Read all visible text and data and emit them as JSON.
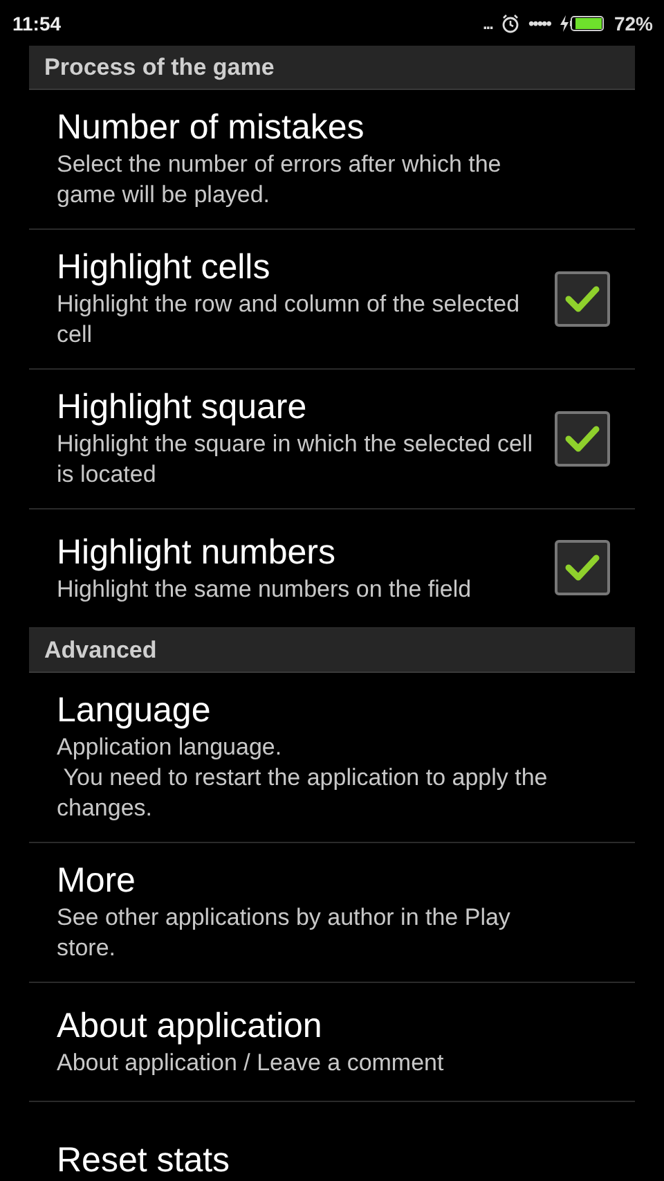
{
  "status_bar": {
    "time": "11:54",
    "overflow": "...",
    "signal": "•••••",
    "battery": "72%"
  },
  "sections": [
    {
      "title": "Process of the game",
      "items": [
        {
          "kind": "plain",
          "title": "Number of mistakes",
          "summary": "Select the number of errors after which the game will be played."
        },
        {
          "kind": "checkbox",
          "title": "Highlight cells",
          "summary": "Highlight the row and column of the selected cell",
          "checked": true
        },
        {
          "kind": "checkbox",
          "title": "Highlight square",
          "summary": "Highlight the square in which the selected cell is located",
          "checked": true
        },
        {
          "kind": "checkbox",
          "title": "Highlight numbers",
          "summary": "Highlight the same numbers on the field",
          "checked": true
        }
      ]
    },
    {
      "title": "Advanced",
      "items": [
        {
          "kind": "plain",
          "title": "Language",
          "summary": "Application language.\n You need to restart the application to apply the changes."
        },
        {
          "kind": "plain",
          "title": "More",
          "summary": "See other applications by author in the Play store."
        },
        {
          "kind": "plain",
          "title": "About application",
          "summary": "About application / Leave a comment"
        },
        {
          "kind": "plain",
          "title": "Reset stats"
        }
      ]
    }
  ]
}
